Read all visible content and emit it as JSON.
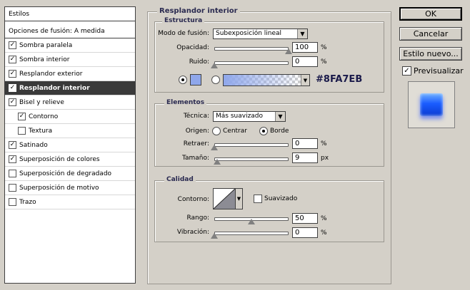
{
  "styles_list": {
    "header": "Estilos",
    "items": [
      {
        "label": "Opciones de fusión: A medida",
        "checkbox": false,
        "checked": false,
        "sub": false,
        "selected": false
      },
      {
        "label": "Sombra paralela",
        "checkbox": true,
        "checked": true,
        "sub": false,
        "selected": false
      },
      {
        "label": "Sombra interior",
        "checkbox": true,
        "checked": true,
        "sub": false,
        "selected": false
      },
      {
        "label": "Resplandor exterior",
        "checkbox": true,
        "checked": true,
        "sub": false,
        "selected": false
      },
      {
        "label": "Resplandor interior",
        "checkbox": true,
        "checked": true,
        "sub": false,
        "selected": true
      },
      {
        "label": "Bisel y relieve",
        "checkbox": true,
        "checked": true,
        "sub": false,
        "selected": false
      },
      {
        "label": "Contorno",
        "checkbox": true,
        "checked": true,
        "sub": true,
        "selected": false
      },
      {
        "label": "Textura",
        "checkbox": true,
        "checked": false,
        "sub": true,
        "selected": false
      },
      {
        "label": "Satinado",
        "checkbox": true,
        "checked": true,
        "sub": false,
        "selected": false
      },
      {
        "label": "Superposición de colores",
        "checkbox": true,
        "checked": true,
        "sub": false,
        "selected": false
      },
      {
        "label": "Superposición de degradado",
        "checkbox": true,
        "checked": false,
        "sub": false,
        "selected": false
      },
      {
        "label": "Superposición de motivo",
        "checkbox": true,
        "checked": false,
        "sub": false,
        "selected": false
      },
      {
        "label": "Trazo",
        "checkbox": true,
        "checked": false,
        "sub": false,
        "selected": false
      }
    ]
  },
  "main": {
    "title": "Resplandor interior",
    "estructura": {
      "title": "Estructura",
      "blend_mode_label": "Modo de fusión:",
      "blend_mode_value": "Subexposición lineal",
      "opacity_label": "Opacidad:",
      "opacity_value": "100",
      "opacity_unit": "%",
      "opacity_fraction": 1.0,
      "noise_label": "Ruido:",
      "noise_value": "0",
      "noise_unit": "%",
      "noise_fraction": 0.0,
      "color_hex": "#8FA7EB"
    },
    "elementos": {
      "title": "Elementos",
      "technique_label": "Técnica:",
      "technique_value": "Más suavizado",
      "source_label": "Origen:",
      "source_center": "Centrar",
      "source_edge": "Borde",
      "choke_label": "Retraer:",
      "choke_value": "0",
      "choke_unit": "%",
      "choke_fraction": 0.0,
      "size_label": "Tamaño:",
      "size_value": "9",
      "size_unit": "px",
      "size_fraction": 0.04
    },
    "calidad": {
      "title": "Calidad",
      "contour_label": "Contorno:",
      "antialias_label": "Suavizado",
      "range_label": "Rango:",
      "range_value": "50",
      "range_unit": "%",
      "range_fraction": 0.5,
      "jitter_label": "Vibración:",
      "jitter_value": "0",
      "jitter_unit": "%",
      "jitter_fraction": 0.0
    }
  },
  "buttons": {
    "ok": "OK",
    "cancel": "Cancelar",
    "new_style": "Estilo nuevo...",
    "preview": "Previsualizar"
  },
  "colors": {
    "glow": "#8FA7EB",
    "selected_row": "#3a3a3a",
    "preview_blue": "#1a5cff"
  }
}
